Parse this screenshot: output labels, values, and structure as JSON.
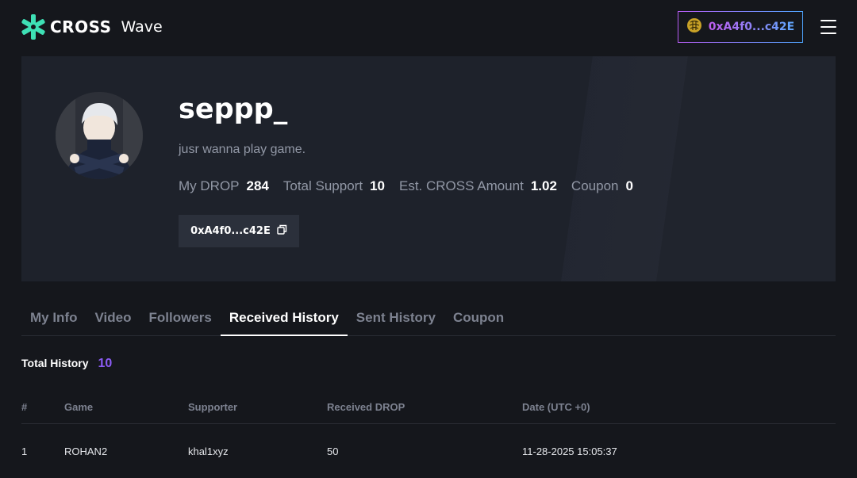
{
  "header": {
    "brand_name": "CROSS",
    "brand_sub": "Wave",
    "wallet_address": "0xA4f0...c42E",
    "accent_gradient": [
      "#c15cf0",
      "#5fa8ff"
    ]
  },
  "profile": {
    "username": "seppp_",
    "bio": "jusr wanna play game.",
    "stats": [
      {
        "label": "My DROP",
        "value": "284"
      },
      {
        "label": "Total Support",
        "value": "10"
      },
      {
        "label": "Est. CROSS Amount",
        "value": "1.02"
      },
      {
        "label": "Coupon",
        "value": "0"
      }
    ],
    "address_chip": "0xA4f0...c42E"
  },
  "tabs": [
    {
      "label": "My Info",
      "active": false
    },
    {
      "label": "Video",
      "active": false
    },
    {
      "label": "Followers",
      "active": false
    },
    {
      "label": "Received History",
      "active": true
    },
    {
      "label": "Sent History",
      "active": false
    },
    {
      "label": "Coupon",
      "active": false
    }
  ],
  "history": {
    "total_label": "Total History",
    "total_value": "10",
    "columns": [
      "#",
      "Game",
      "Supporter",
      "Received DROP",
      "Date (UTC +0)"
    ],
    "rows": [
      [
        "1",
        "ROHAN2",
        "khal1xyz",
        "50",
        "11-28-2025 15:05:37"
      ]
    ]
  }
}
